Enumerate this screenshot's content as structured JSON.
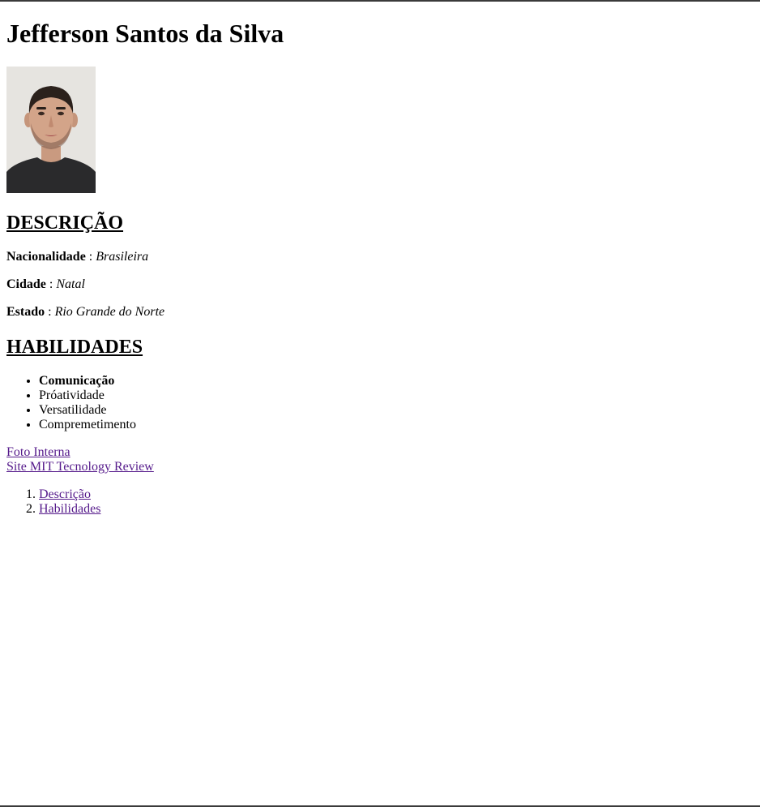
{
  "profile": {
    "name": "Jefferson Santos da Silva"
  },
  "description": {
    "heading": "DESCRIÇÃO",
    "fields": [
      {
        "label": "Nacionalidade",
        "separator": ":",
        "value": "Brasileira"
      },
      {
        "label": "Cidade",
        "separator": ":",
        "value": "Natal"
      },
      {
        "label": "Estado",
        "separator": ":",
        "value": "Rio Grande do Norte"
      }
    ]
  },
  "skills": {
    "heading": "HABILIDADES",
    "items": [
      {
        "label": "Comunicação"
      },
      {
        "label": "Próatividade"
      },
      {
        "label": "Versatilidade"
      },
      {
        "label": "Compremetimento"
      }
    ]
  },
  "links": [
    {
      "label": "Foto Interna"
    },
    {
      "label": "Site MIT Tecnology Review"
    }
  ],
  "nav": [
    {
      "label": "Descrição"
    },
    {
      "label": "Habilidades"
    }
  ],
  "colors": {
    "visited_link": "#551a8b",
    "text": "#000000",
    "background": "#ffffff"
  }
}
